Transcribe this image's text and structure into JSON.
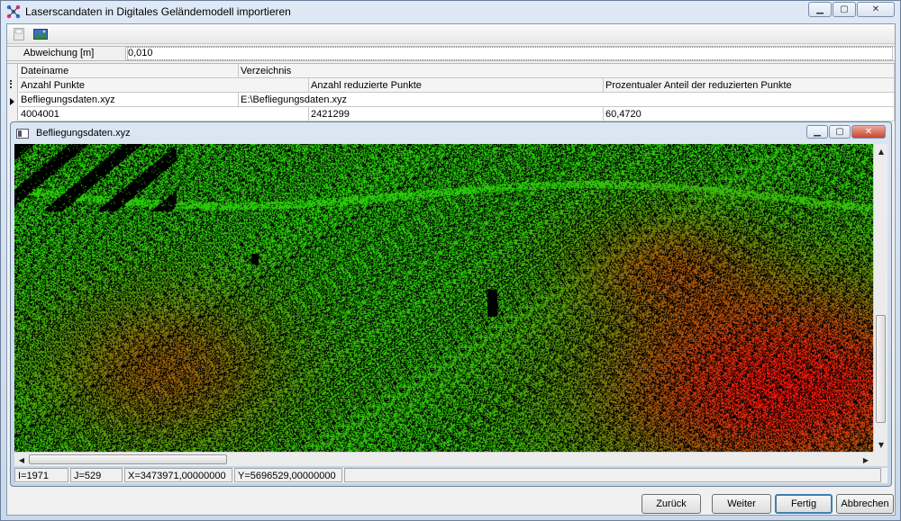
{
  "window": {
    "title": "Laserscandaten in Digitales Geländemodell importieren",
    "icon": "network-icon",
    "controls": [
      "minimize-icon",
      "maximize-icon",
      "close-icon"
    ]
  },
  "toolbar": {
    "items": [
      "disk-icon",
      "image-icon"
    ]
  },
  "parameter": {
    "label": "Abweichung [m]",
    "value": "0,010"
  },
  "grid": {
    "headers_row1": [
      "Dateiname",
      "Verzeichnis"
    ],
    "headers_row2": [
      "Anzahl Punkte",
      "Anzahl reduzierte Punkte",
      "Prozentualer Anteil der reduzierten Punkte"
    ],
    "row": {
      "dateiname": "Befliegungsdaten.xyz",
      "verzeichnis": "E:\\Befliegungsdaten.xyz",
      "anzahl_punkte": "4004001",
      "anzahl_reduziert": "2421299",
      "prozent": "60,4720"
    }
  },
  "child_window": {
    "title": "Befliegungsdaten.xyz"
  },
  "status": {
    "i": "I=1971",
    "j": "J=529",
    "x": "X=3473971,00000000",
    "y": "Y=5696529,00000000"
  },
  "buttons": {
    "back": "Zurück",
    "next": "Weiter",
    "finish": "Fertig",
    "cancel": "Abbrechen"
  },
  "colors": {
    "point_low": "#22cc22",
    "point_high": "#ff2200",
    "background": "#000000"
  }
}
